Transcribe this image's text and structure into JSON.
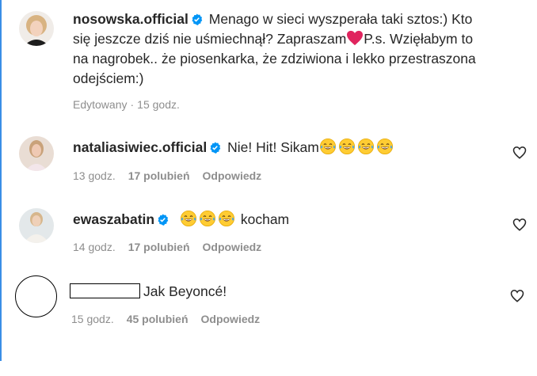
{
  "post": {
    "username": "nosowska.official",
    "caption_line1": "Menago w sieci wyszperała taki sztos:) Kto",
    "caption_line2a": "się jeszcze dziś nie uśmiechnął? Zapraszam",
    "caption_line2b": "P.s. Wzięłabym to",
    "caption_line3": "na nagrobek.. że piosenkarka, że zdziwiona i lekko przestraszona",
    "caption_line4": "odejściem:)",
    "edited_label": "Edytowany",
    "separator": "·",
    "time": "15 godz."
  },
  "comments": [
    {
      "username": "nataliasiwiec.official",
      "text": "Nie! Hit! Sikam",
      "time": "13 godz.",
      "likes": "17 polubień",
      "reply": "Odpowiedz",
      "emoji_count": 4
    },
    {
      "username": "ewaszabatin",
      "text": "kocham",
      "time": "14 godz.",
      "likes": "17 polubień",
      "reply": "Odpowiedz",
      "emoji_count": 3
    },
    {
      "username": "",
      "text": "Jak Beyoncé!",
      "time": "15 godz.",
      "likes": "45 polubień",
      "reply": "Odpowiedz"
    }
  ],
  "icons": {
    "verified": "verified-badge-icon",
    "emoji": "face-with-tears-of-joy-icon",
    "heart_inline": "red-heart-icon",
    "like": "heart-outline-icon"
  },
  "colors": {
    "text": "#262626",
    "meta": "#8e8e8e",
    "verified": "#0095f6",
    "heart": "#e0245e"
  }
}
